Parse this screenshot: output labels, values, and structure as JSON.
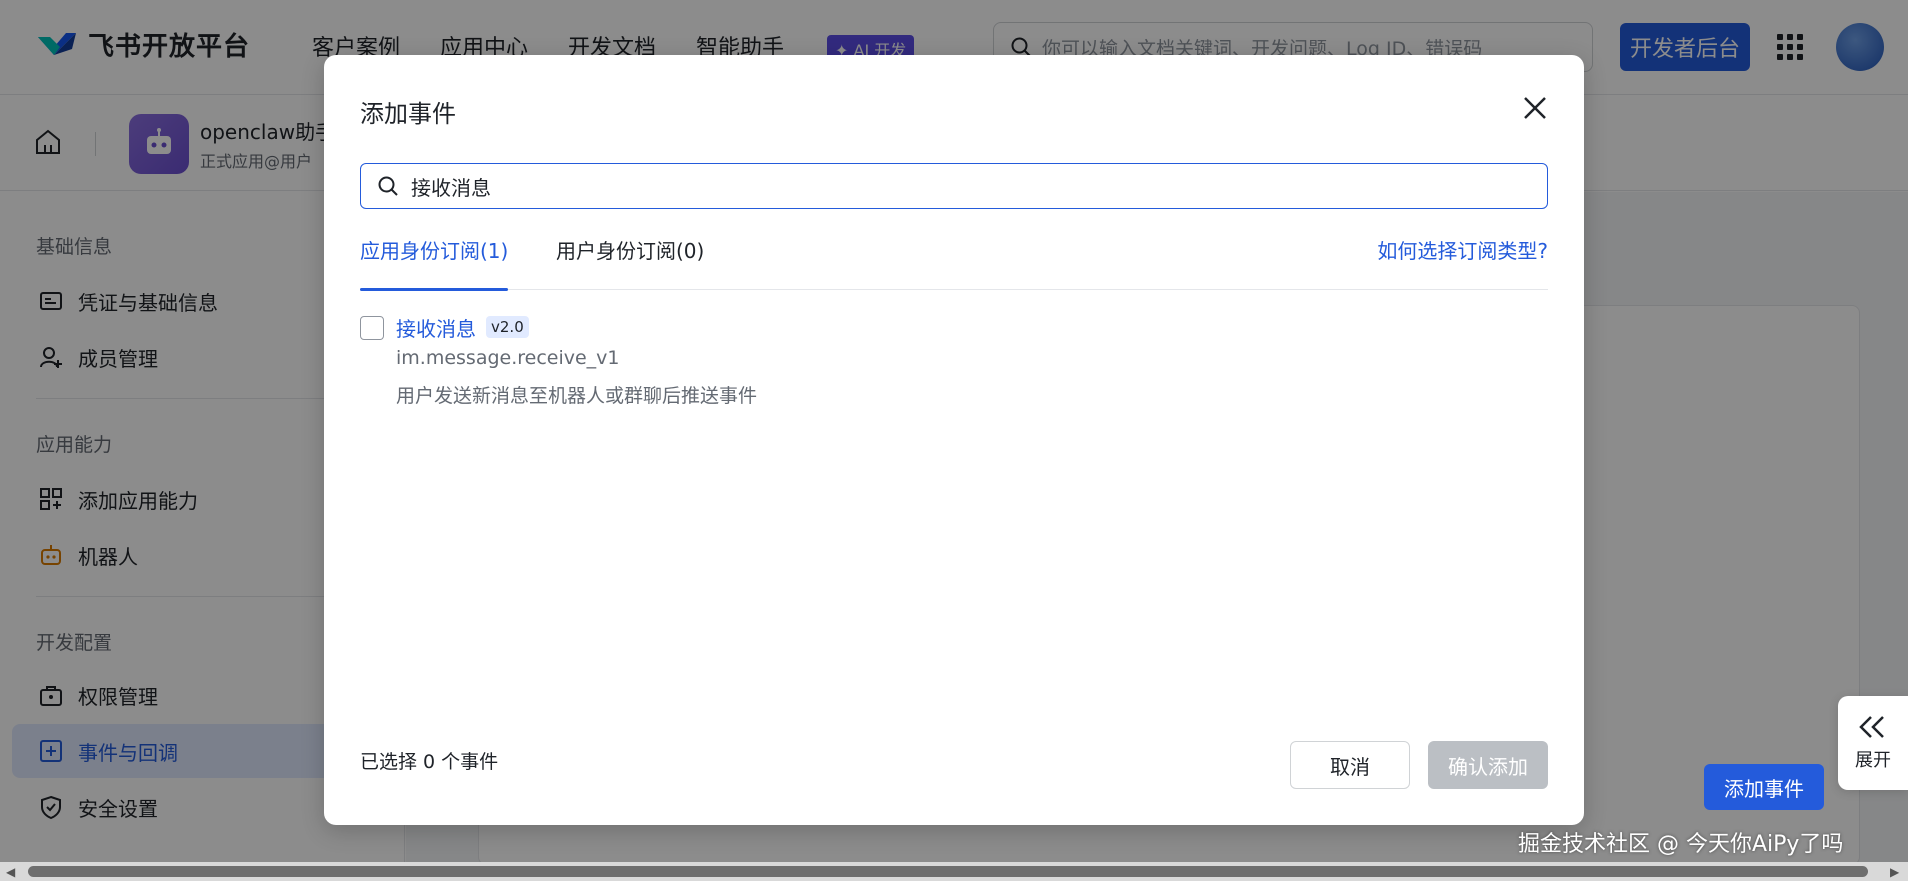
{
  "topnav": {
    "brand": "飞书开放平台",
    "links": [
      "客户案例",
      "应用中心",
      "开发文档",
      "智能助手"
    ],
    "ai_badge": "✦ AI 开发",
    "search_placeholder": "你可以输入文档关键词、开发问题、Log ID、错误码",
    "dev_button": "开发者后台"
  },
  "apphead": {
    "app_name": "openclaw助手",
    "app_sub": "正式应用@用户"
  },
  "sidebar": {
    "sections": [
      {
        "title": "基础信息",
        "items": [
          "凭证与基础信息",
          "成员管理"
        ]
      },
      {
        "title": "应用能力",
        "items": [
          "添加应用能力",
          "机器人"
        ]
      },
      {
        "title": "开发配置",
        "items": [
          "权限管理",
          "事件与回调",
          "安全设置"
        ]
      }
    ],
    "active_item": "事件与回调"
  },
  "background": {
    "add_event_button": "添加事件",
    "expand_label": "展开"
  },
  "modal": {
    "title": "添加事件",
    "search_value": "接收消息",
    "tabs": [
      {
        "label": "应用身份订阅(1)",
        "active": true
      },
      {
        "label": "用户身份订阅(0)",
        "active": false
      }
    ],
    "help_link": "如何选择订阅类型?",
    "events": [
      {
        "name": "接收消息",
        "version": "v2.0",
        "key": "im.message.receive_v1",
        "description": "用户发送新消息至机器人或群聊后推送事件",
        "checked": false
      }
    ],
    "selected_count": "已选择 0 个事件",
    "cancel_label": "取消",
    "confirm_label": "确认添加"
  },
  "watermark": "掘金技术社区 @ 今天你AiPy了吗",
  "colors": {
    "primary": "#245bdb",
    "ai_badge": "#5b4de6",
    "disabled_button": "#bbbfc4",
    "active_bg": "#e1eaff"
  }
}
